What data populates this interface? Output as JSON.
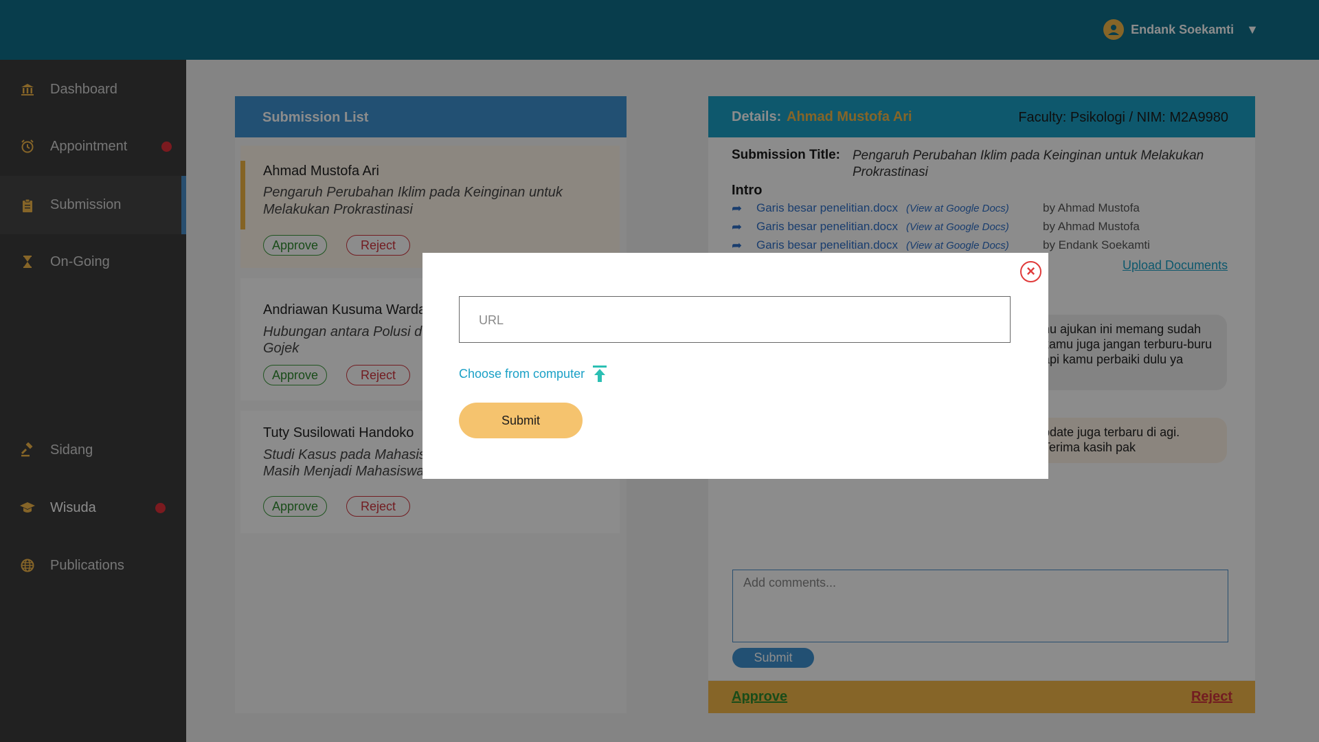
{
  "user": {
    "name": "Endank Soekamti"
  },
  "sidebar": {
    "items": [
      {
        "label": "Dashboard"
      },
      {
        "label": "Appointment"
      },
      {
        "label": "Submission"
      },
      {
        "label": "On-Going"
      },
      {
        "label": "Sidang"
      },
      {
        "label": "Wisuda"
      },
      {
        "label": "Publications"
      }
    ]
  },
  "submission_list": {
    "title": "Submission List",
    "items": [
      {
        "name": "Ahmad Mustofa Ari",
        "title": "Pengaruh Perubahan Iklim pada Keinginan untuk Melakukan Prokrastinasi",
        "approve": "Approve",
        "reject": "Reject"
      },
      {
        "name": "Andriawan Kusuma Warda",
        "title": "Hubungan antara Polusi d... Gojek",
        "title_line1": "Hubungan antara Polusi d",
        "title_line2": "Gojek",
        "approve": "Approve",
        "reject": "Reject"
      },
      {
        "name": "Tuty Susilowati Handoko",
        "title_line1": "Studi Kasus pada Mahasis",
        "title_line2": "Masih Menjadi Mahasiswa",
        "approve": "Approve",
        "reject": "Reject"
      }
    ]
  },
  "details": {
    "label": "Details:",
    "name": "Ahmad Mustofa Ari",
    "faculty": "Faculty: Psikologi  / NIM: M2A9980",
    "submission_title_label": "Submission Title:",
    "submission_title": "Pengaruh Perubahan Iklim pada Keinginan untuk Melakukan Prokrastinasi",
    "intro_label": "Intro",
    "documents": [
      {
        "file": "Garis besar penelitian.docx",
        "link": "(View at Google Docs)",
        "by": "by Ahmad Mustofa"
      },
      {
        "file": "Garis besar penelitian.docx",
        "link": "(View at Google Docs)",
        "by": "by Ahmad Mustofa"
      },
      {
        "file": "Garis besar penelitian.docx",
        "link": "(View at Google Docs)",
        "by": "by Endank Soekamti"
      }
    ],
    "upload_label": "Upload Documents",
    "comments": [
      {
        "text": "nu ajukan ini memang sudah kamu juga jangan terburu-buru api kamu  perbaiki dulu ya"
      },
      {
        "text": "pdate juga terbaru di agi. Terima kasih pak"
      }
    ],
    "comment_placeholder": "Add comments...",
    "comment_submit": "Submit",
    "approve": "Approve",
    "reject": "Reject"
  },
  "modal": {
    "url_placeholder": "URL",
    "choose_label": "Choose from computer",
    "submit_label": "Submit"
  },
  "colors": {
    "header": "#0f6f8a",
    "sidebar": "#3c3c3c",
    "accent_blue": "#3f93d2",
    "accent_orange": "#f5b94a",
    "approve_green": "#2f8a2f",
    "reject_red": "#d0343c"
  }
}
